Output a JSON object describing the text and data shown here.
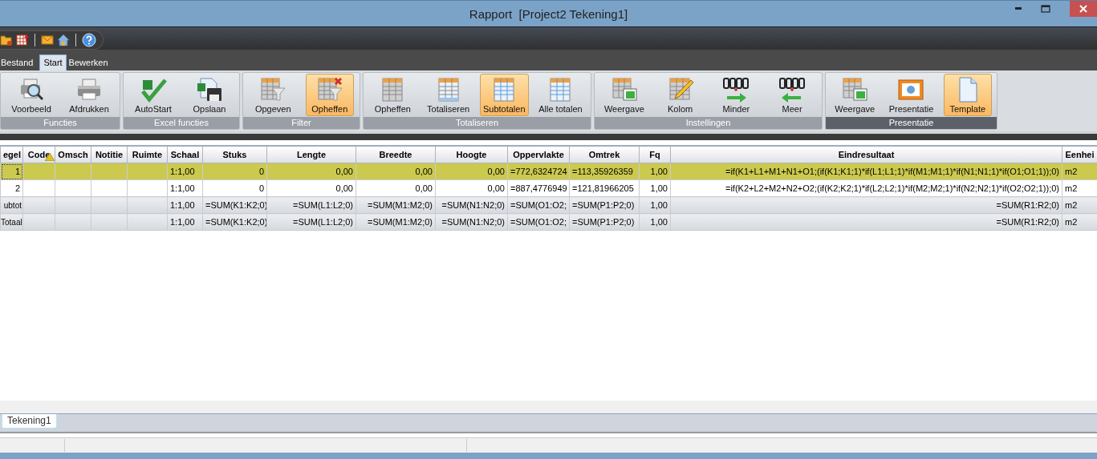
{
  "window": {
    "title": "Rapport  [Project2 Tekening1]"
  },
  "quick_access": [
    {
      "kind": "folder"
    },
    {
      "kind": "grid"
    },
    {
      "kind": "separator"
    },
    {
      "kind": "mail"
    },
    {
      "kind": "home"
    },
    {
      "kind": "separator"
    },
    {
      "kind": "help"
    }
  ],
  "tabs": [
    {
      "label": "Bestand",
      "selected": false
    },
    {
      "label": "Start",
      "selected": true
    },
    {
      "label": "Bewerken",
      "selected": false
    }
  ],
  "ribbon_groups": [
    {
      "label": "Functies",
      "buttons": [
        {
          "label": "Voorbeeld",
          "selected": false
        },
        {
          "label": "Afdrukken",
          "selected": false
        }
      ]
    },
    {
      "label": "Excel functies",
      "buttons": [
        {
          "label": "AutoStart",
          "selected": false
        },
        {
          "label": "Opslaan",
          "selected": false
        }
      ]
    },
    {
      "label": "Filter",
      "buttons": [
        {
          "label": "Opgeven",
          "selected": false
        },
        {
          "label": "Opheffen",
          "selected": true
        }
      ]
    },
    {
      "label": "Totaliseren",
      "buttons": [
        {
          "label": "Opheffen",
          "selected": false
        },
        {
          "label": "Totaliseren",
          "selected": false
        },
        {
          "label": "Subtotalen",
          "selected": true
        },
        {
          "label": "Alle totalen",
          "selected": false
        }
      ]
    },
    {
      "label": "Instellingen",
      "buttons": [
        {
          "label": "Weergave",
          "selected": false
        },
        {
          "label": "Kolom",
          "selected": false
        },
        {
          "label": "Minder",
          "selected": false
        },
        {
          "label": "Meer",
          "selected": false
        }
      ]
    },
    {
      "label": "Presentatie",
      "buttons": [
        {
          "label": "Weergave",
          "selected": false
        },
        {
          "label": "Presentatie",
          "selected": false
        },
        {
          "label": "Template",
          "selected": true
        }
      ]
    }
  ],
  "table": {
    "columns": [
      "egel",
      "Code",
      "Omsch",
      "Notitie",
      "Ruimte",
      "Schaal",
      "Stuks",
      "Lengte",
      "Breedte",
      "Hoogte",
      "Oppervlakte",
      "Omtrek",
      "Fq",
      "Eindresultaat",
      "Eenhei"
    ],
    "rows": [
      {
        "kind": "data",
        "selected": true,
        "cells": [
          "1",
          "",
          "",
          "",
          "",
          "1:1,00",
          "0",
          "0,00",
          "0,00",
          "0,00",
          "=772,6324724",
          "=113,35926359",
          "1,00",
          "=if(K1+L1+M1+N1+O1;(if(K1;K1;1)*if(L1;L1;1)*if(M1;M1;1)*if(N1;N1;1)*if(O1;O1;1));0)",
          "m2"
        ]
      },
      {
        "kind": "data",
        "selected": false,
        "cells": [
          "2",
          "",
          "",
          "",
          "",
          "1:1,00",
          "0",
          "0,00",
          "0,00",
          "0,00",
          "=887,4776949",
          "=121,81966205",
          "1,00",
          "=if(K2+L2+M2+N2+O2;(if(K2;K2;1)*if(L2;L2;1)*if(M2;M2;1)*if(N2;N2;1)*if(O2;O2;1));0)",
          "m2"
        ]
      },
      {
        "kind": "total",
        "selected": false,
        "cells": [
          "ubtot",
          "",
          "",
          "",
          "",
          "1:1,00",
          "=SUM(K1:K2;0)",
          "=SUM(L1:L2;0)",
          "=SUM(M1:M2;0)",
          "=SUM(N1:N2;0)",
          "=SUM(O1:O2;",
          "=SUM(P1:P2;0)",
          "1,00",
          "=SUM(R1:R2;0)",
          "m2"
        ]
      },
      {
        "kind": "total",
        "selected": false,
        "cells": [
          "Totaal",
          "",
          "",
          "",
          "",
          "1:1,00",
          "=SUM(K1:K2;0)",
          "=SUM(L1:L2;0)",
          "=SUM(M1:M2;0)",
          "=SUM(N1:N2;0)",
          "=SUM(O1:O2;",
          "=SUM(P1:P2;0)",
          "1,00",
          "=SUM(R1:R2;0)",
          "m2"
        ]
      }
    ]
  },
  "sheet_tabs": [
    {
      "label": "Tekening1"
    }
  ]
}
